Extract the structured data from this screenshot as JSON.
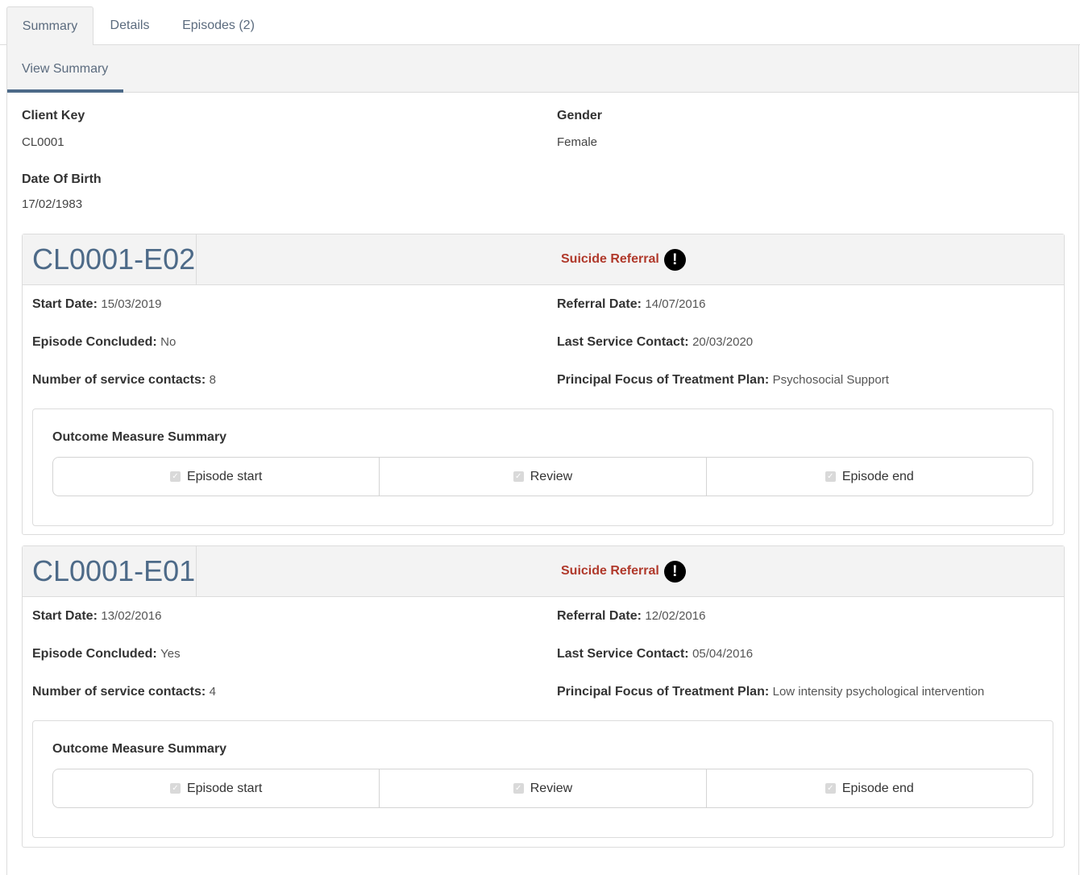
{
  "tabs": [
    {
      "label": "Summary",
      "active": true
    },
    {
      "label": "Details",
      "active": false
    },
    {
      "label": "Episodes (2)",
      "active": false
    }
  ],
  "subtab": {
    "label": "View Summary"
  },
  "client": {
    "client_key_label": "Client Key",
    "client_key": "CL0001",
    "gender_label": "Gender",
    "gender": "Female",
    "dob_label": "Date Of Birth",
    "dob": "17/02/1983"
  },
  "labels": {
    "start_date": "Start Date:",
    "referral_date": "Referral Date:",
    "episode_concluded": "Episode Concluded:",
    "last_service_contact": "Last Service Contact:",
    "number_of_contacts": "Number of service contacts:",
    "principal_focus": "Principal Focus of Treatment Plan:",
    "outcome_title": "Outcome Measure Summary"
  },
  "episodes": [
    {
      "id": "CL0001-E02",
      "flag": "Suicide Referral",
      "start_date": "15/03/2019",
      "referral_date": "14/07/2016",
      "concluded": "No",
      "last_contact": "20/03/2020",
      "contacts": "8",
      "focus": "Psychosocial Support",
      "outcomes": [
        "Episode start",
        "Review",
        "Episode end"
      ]
    },
    {
      "id": "CL0001-E01",
      "flag": "Suicide Referral",
      "start_date": "13/02/2016",
      "referral_date": "12/02/2016",
      "concluded": "Yes",
      "last_contact": "05/04/2016",
      "contacts": "4",
      "focus": "Low intensity psychological intervention",
      "outcomes": [
        "Episode start",
        "Review",
        "Episode end"
      ]
    }
  ],
  "colors": {
    "accent": "#4d6a88",
    "flag": "#b0392b",
    "panel_bg": "#f3f3f3"
  }
}
